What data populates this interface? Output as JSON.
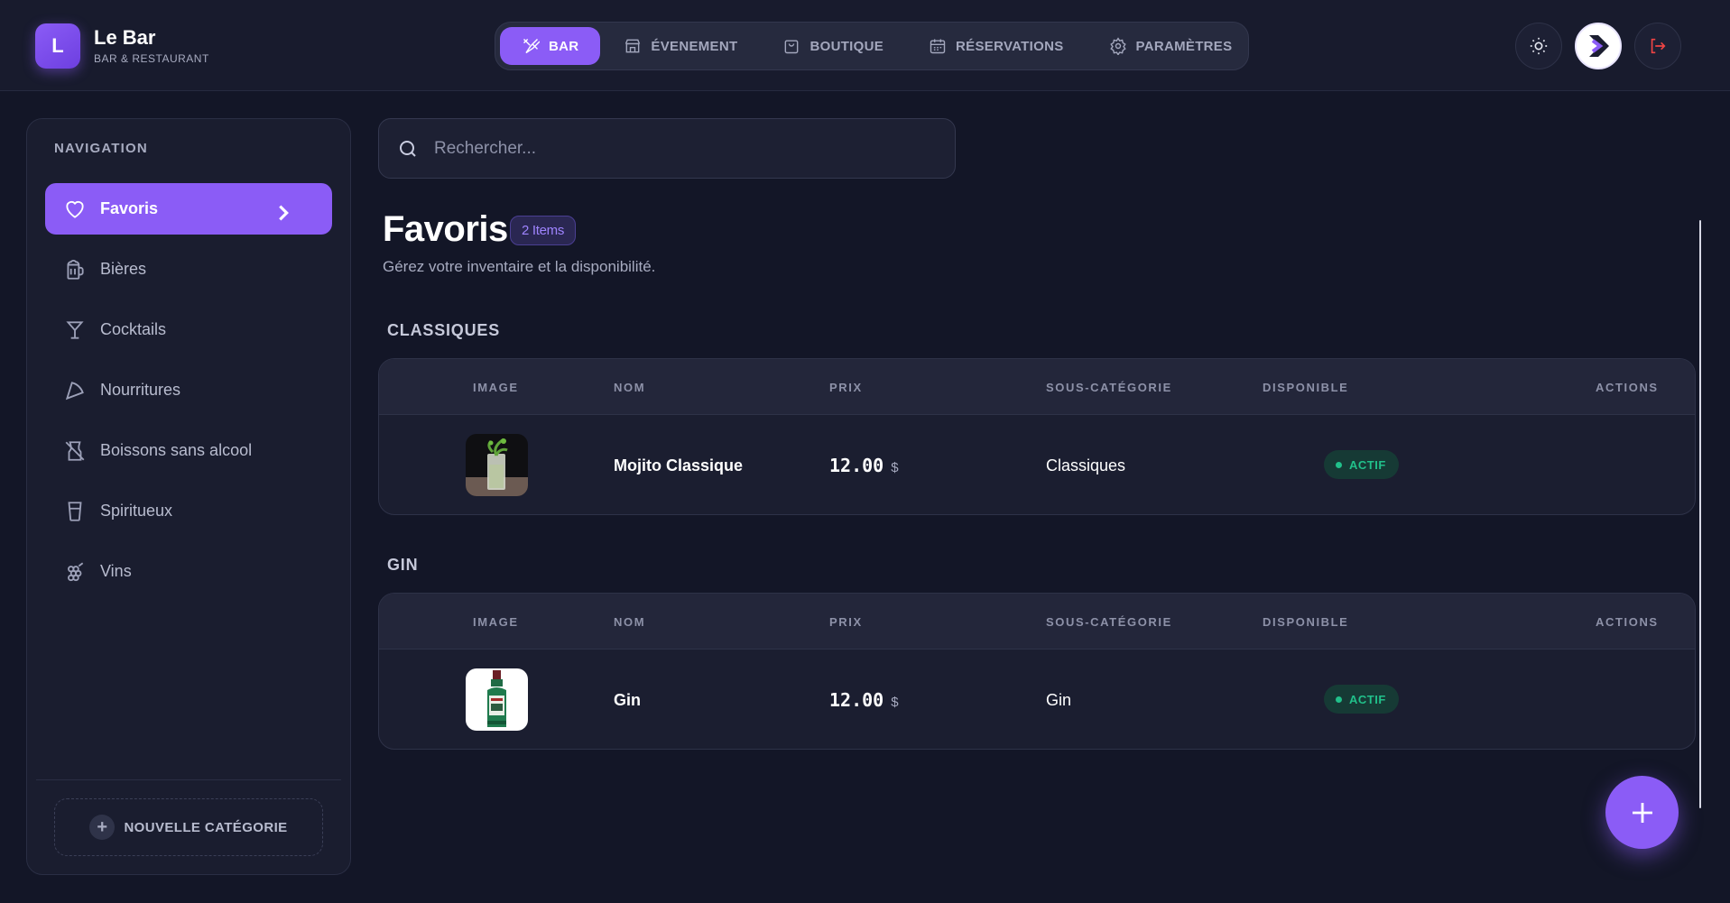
{
  "brand": {
    "logo_letter": "L",
    "title": "Le Bar",
    "subtitle": "BAR & RESTAURANT"
  },
  "topnav": [
    {
      "label": "BAR",
      "icon": "utensils-crossed-icon",
      "active": true
    },
    {
      "label": "ÉVENEMENT",
      "icon": "store-icon",
      "active": false
    },
    {
      "label": "BOUTIQUE",
      "icon": "shopping-bag-icon",
      "active": false
    },
    {
      "label": "RÉSERVATIONS",
      "icon": "calendar-icon",
      "active": false
    },
    {
      "label": "PARAMÈTRES",
      "icon": "gear-icon",
      "active": false
    }
  ],
  "header_actions": {
    "theme_icon": "sun-icon",
    "avatar_icon": "user-avatar",
    "logout_icon": "logout-icon"
  },
  "sidebar": {
    "heading": "NAVIGATION",
    "items": [
      {
        "label": "Favoris",
        "icon": "heart-icon",
        "active": true
      },
      {
        "label": "Bières",
        "icon": "beer-icon",
        "active": false
      },
      {
        "label": "Cocktails",
        "icon": "martini-icon",
        "active": false
      },
      {
        "label": "Nourritures",
        "icon": "pizza-icon",
        "active": false
      },
      {
        "label": "Boissons sans alcool",
        "icon": "no-alcohol-icon",
        "active": false
      },
      {
        "label": "Spiritueux",
        "icon": "glass-icon",
        "active": false
      },
      {
        "label": "Vins",
        "icon": "grape-icon",
        "active": false
      }
    ],
    "new_category_label": "NOUVELLE CATÉGORIE"
  },
  "search": {
    "placeholder": "Rechercher..."
  },
  "page": {
    "title": "Favoris",
    "badge": "2 Items",
    "subtitle": "Gérez votre inventaire et la disponibilité."
  },
  "table_headers": {
    "image": "IMAGE",
    "name": "NOM",
    "price": "PRIX",
    "subcategory": "SOUS-CATÉGORIE",
    "available": "DISPONIBLE",
    "actions": "ACTIONS"
  },
  "sections": [
    {
      "title": "CLASSIQUES",
      "rows": [
        {
          "image": "mojito-thumbnail",
          "name": "Mojito Classique",
          "price": "12.00",
          "currency": "$",
          "subcategory": "Classiques",
          "status": "ACTIF"
        }
      ]
    },
    {
      "title": "GIN",
      "rows": [
        {
          "image": "gin-bottle-thumbnail",
          "name": "Gin",
          "price": "12.00",
          "currency": "$",
          "subcategory": "Gin",
          "status": "ACTIF"
        }
      ]
    }
  ],
  "colors": {
    "accent": "#8b5cf6",
    "background": "#131627",
    "panel": "#1a1d2f",
    "status_active_text": "#21c08a",
    "status_active_bg": "#163a35",
    "logout": "#ef4444"
  },
  "fab": {
    "icon": "plus-icon"
  }
}
